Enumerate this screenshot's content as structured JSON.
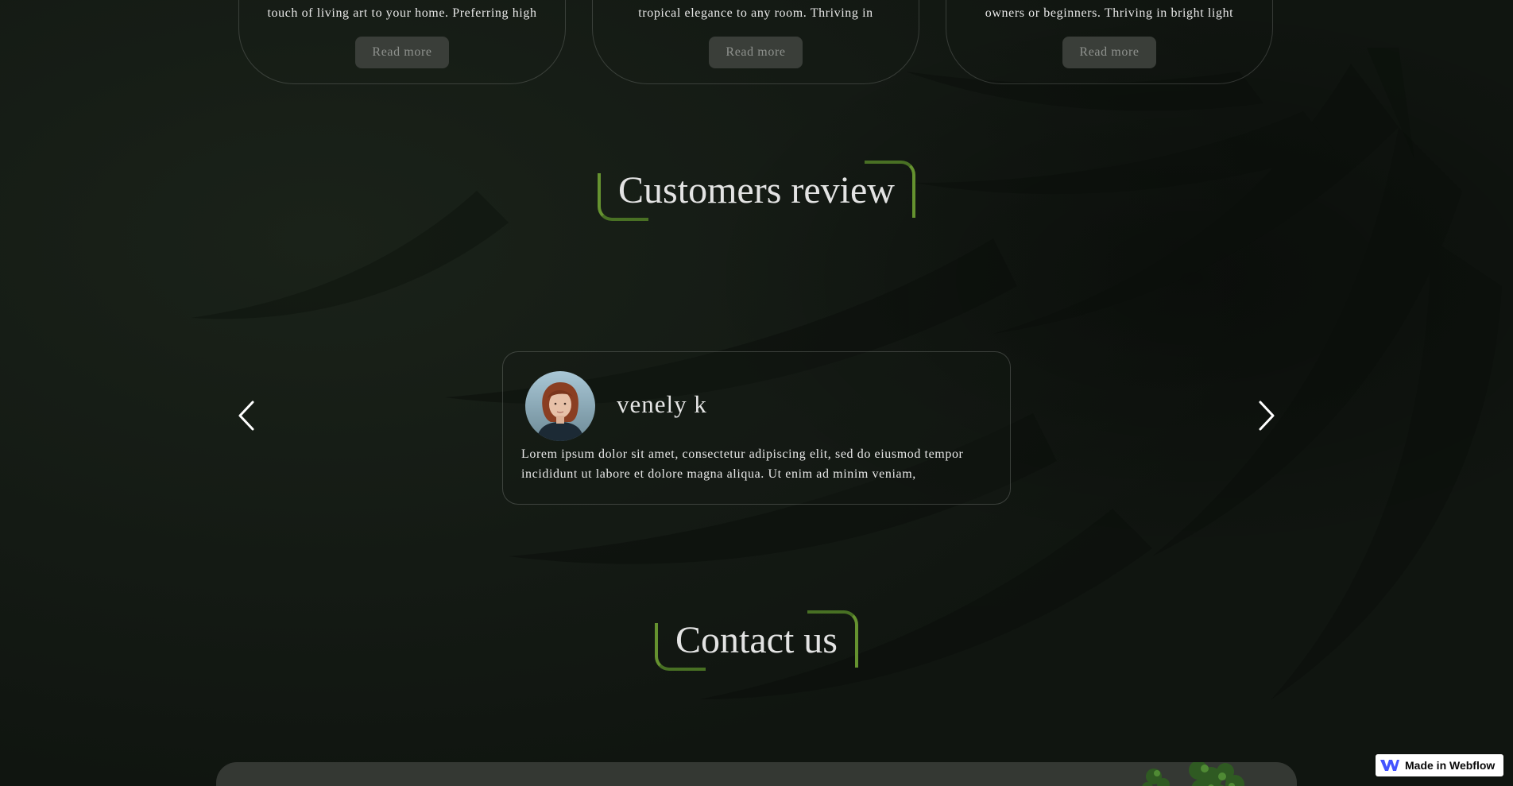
{
  "cards": [
    {
      "text": "touch of living art to your home. Preferring high",
      "button": "Read more"
    },
    {
      "text": "tropical elegance to any room. Thriving in",
      "button": "Read more"
    },
    {
      "text": "owners or beginners. Thriving in bright light",
      "button": "Read more"
    }
  ],
  "reviews_section": {
    "title": "Customers review",
    "review": {
      "name": "venely k",
      "text": "Lorem ipsum dolor sit amet, consectetur adipiscing elit, sed do eiusmod tempor incididunt ut labore et dolore magna aliqua. Ut enim ad minim veniam,"
    },
    "prev_icon": "chevron-left-icon",
    "next_icon": "chevron-right-icon"
  },
  "contact_section": {
    "title": "Contact us"
  },
  "badge": {
    "label": "Made in Webflow",
    "icon": "webflow-logo-icon"
  },
  "colors": {
    "background": "#121712",
    "accent_green": "#6fa033",
    "button_bg": "#3a3e39",
    "panel_bg": "#343833"
  }
}
